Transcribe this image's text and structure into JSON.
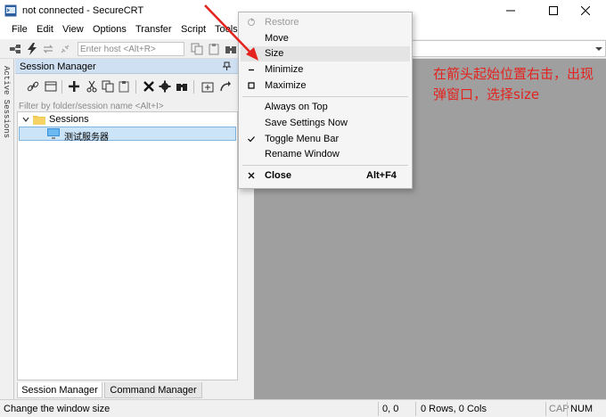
{
  "window": {
    "title": "not connected - SecureCRT",
    "brand_color": "#4a7ab8"
  },
  "menubar": {
    "items": [
      "File",
      "Edit",
      "View",
      "Options",
      "Transfer",
      "Script",
      "Tools"
    ]
  },
  "toolbar": {
    "host_placeholder": "Enter host <Alt+R>"
  },
  "active_sessions": {
    "label": "Active Sessions"
  },
  "session_manager": {
    "title": "Session Manager",
    "filter_placeholder": "Filter by folder/session name <Alt+I>",
    "tree": {
      "folder": "Sessions",
      "session": "测试服务器"
    },
    "tabs": [
      "Session Manager",
      "Command Manager"
    ]
  },
  "context_menu": {
    "items": [
      {
        "label": "Restore",
        "mark": "restore-icon",
        "disabled": true
      },
      {
        "label": "Move"
      },
      {
        "label": "Size",
        "highlighted": true
      },
      {
        "label": "Minimize",
        "mark": "minimize-icon"
      },
      {
        "label": "Maximize",
        "mark": "maximize-icon"
      },
      {
        "label": "Always on Top"
      },
      {
        "label": "Save Settings Now"
      },
      {
        "label": "Toggle Menu Bar",
        "mark": "check-icon"
      },
      {
        "label": "Rename Window"
      },
      {
        "label": "Close",
        "mark": "close-icon",
        "shortcut": "Alt+F4"
      }
    ]
  },
  "annotation": {
    "text": "在箭头起始位置右击，出现弹窗口，选择size",
    "color": "#e4231e"
  },
  "statusbar": {
    "message": "Change the window size",
    "position": "0, 0",
    "rows_cols": "0 Rows, 0 Cols",
    "cap": "CAP",
    "num": "NUM"
  }
}
